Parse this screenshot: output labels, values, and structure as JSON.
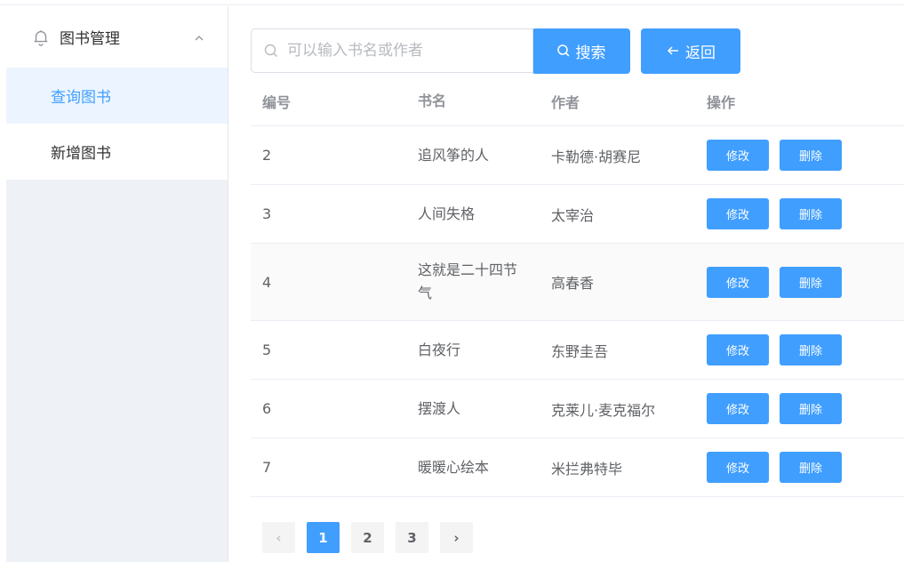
{
  "colors": {
    "primary": "#409eff",
    "active_bg": "#ecf5ff",
    "sidebar_bg": "#eef1f6"
  },
  "sidebar": {
    "submenu": {
      "title": "图书管理",
      "icon": "bell-icon",
      "arrow_icon": "chevron-up-icon"
    },
    "items": [
      {
        "label": "查询图书",
        "active": true
      },
      {
        "label": "新增图书",
        "active": false
      }
    ]
  },
  "search": {
    "value": "",
    "placeholder": "可以输入书名或作者",
    "search_label": "搜索",
    "back_label": "返回"
  },
  "table": {
    "headers": {
      "id": "编号",
      "name": "书名",
      "author": "作者",
      "ops": "操作"
    },
    "rows": [
      {
        "id": "2",
        "name": "追风筝的人",
        "author": "卡勒德·胡赛尼",
        "edit": "修改",
        "delete": "删除"
      },
      {
        "id": "3",
        "name": "人间失格",
        "author": "太宰治",
        "edit": "修改",
        "delete": "删除"
      },
      {
        "id": "4",
        "name": "这就是二十四节气",
        "author": "高春香",
        "edit": "修改",
        "delete": "删除"
      },
      {
        "id": "5",
        "name": "白夜行",
        "author": "东野圭吾",
        "edit": "修改",
        "delete": "删除"
      },
      {
        "id": "6",
        "name": "摆渡人",
        "author": "克莱儿·麦克福尔",
        "edit": "修改",
        "delete": "删除"
      },
      {
        "id": "7",
        "name": "暖暖心绘本",
        "author": "米拦弗特毕",
        "edit": "修改",
        "delete": "删除"
      }
    ]
  },
  "pagination": {
    "prev": "‹",
    "next": "›",
    "pages": [
      "1",
      "2",
      "3"
    ],
    "current": "1"
  }
}
